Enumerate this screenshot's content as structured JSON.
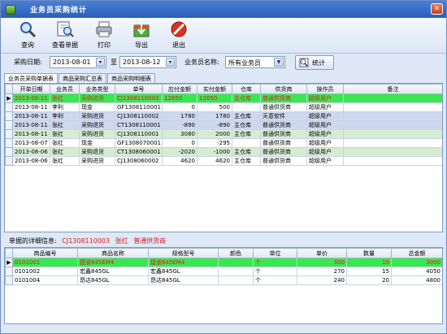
{
  "window": {
    "title": "业务员采购统计",
    "accent": "#2a5fb8"
  },
  "toolbar": {
    "query": "查询",
    "view_receipt": "查看单据",
    "print": "打印",
    "export": "导出",
    "exit": "退出"
  },
  "filter": {
    "date_label": "采购日期:",
    "date_from": "2013-08-01",
    "to_label": "至",
    "date_to": "2013-08-12",
    "salesman_label": "业务员名称:",
    "salesman_value": "所有业务员",
    "stat_button": "统计"
  },
  "tabs": [
    "业务员采购单据表",
    "商品采购汇总表",
    "商品采购明细表"
  ],
  "main_table": {
    "columns": [
      "开单日期",
      "业务员",
      "业务类型",
      "单号",
      "应付金额",
      "实付金额",
      "仓库",
      "供货商",
      "操作员",
      "备注"
    ],
    "rows": [
      [
        "2013-08-11",
        "张红",
        "采购进货",
        "CJ1308110003",
        "12650",
        "12650",
        "主仓库",
        "普通供货商",
        "超级用户",
        ""
      ],
      [
        "2013-08-11",
        "李利",
        "现金",
        "GF1308110001",
        "0",
        "500",
        "",
        "普通供货商",
        "超级用户",
        ""
      ],
      [
        "2013-08-11",
        "李利",
        "采购进货",
        "CJ1308110002",
        "1780",
        "1780",
        "主仓库",
        "天意软件",
        "超级用户",
        ""
      ],
      [
        "2013-08-11",
        "张红",
        "采购退货",
        "CT1308110001",
        "-890",
        "-890",
        "主仓库",
        "普通供货商",
        "超级用户",
        ""
      ],
      [
        "2013-08-11",
        "张红",
        "采购进货",
        "CJ1308110001",
        "3080",
        "2000",
        "主仓库",
        "普通供货商",
        "超级用户",
        ""
      ],
      [
        "2013-08-07",
        "张红",
        "现金",
        "GF1308070001",
        "0",
        "-295",
        "",
        "普通供货商",
        "超级用户",
        ""
      ],
      [
        "2013-08-06",
        "张红",
        "采购退货",
        "CT1308060001",
        "-2020",
        "-1000",
        "主仓库",
        "普通供货商",
        "超级用户",
        ""
      ],
      [
        "2013-08-06",
        "张红",
        "采购进货",
        "CJ1308060002",
        "4620",
        "4620",
        "主仓库",
        "普通供货商",
        "超级用户",
        ""
      ]
    ]
  },
  "detail": {
    "label": "单据的详细信息:",
    "receipt_no": "CJ1308110003",
    "salesman": "张红",
    "supplier": "普通供货商"
  },
  "detail_table": {
    "columns": [
      "商品编号",
      "商品名称",
      "规格型号",
      "颜色",
      "单位",
      "单价",
      "数量",
      "总金额"
    ],
    "rows": [
      [
        "0101001",
        "捷波845EM4",
        "捷波845EM4",
        "",
        "个",
        "300",
        "10",
        "3000"
      ],
      [
        "0101002",
        "宏鑫845GL",
        "宏鑫845GL",
        "",
        "个",
        "270",
        "15",
        "4050"
      ],
      [
        "0101004",
        "昂达845GL",
        "昂达845GL",
        "",
        "个",
        "240",
        "20",
        "4800"
      ]
    ]
  }
}
